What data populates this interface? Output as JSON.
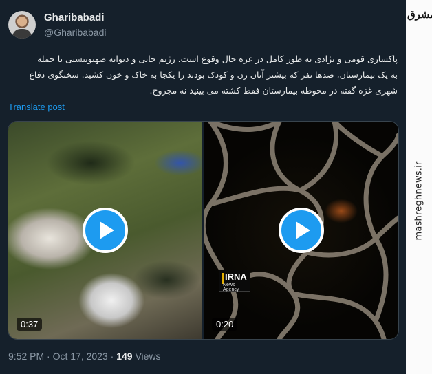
{
  "author": {
    "name": "Gharibabadi",
    "handle": "@Gharibabadi"
  },
  "tweet": {
    "lines": [
      "پاکسازی قومی و نژادی به طور کامل در غزه حال وقوع است. رژیم جانی و دیوانه صهیونیستی با حمله",
      "به یک بیمارستان، صدها نفر که بیشتر آنان زن و کودک بودند را یکجا به خاک و خون کشید. سخنگوی دفاع",
      "شهری غزه گفته در محوطه بیمارستان فقط کشته می بینید نه مجروح."
    ],
    "translate_label": "Translate post"
  },
  "videos": [
    {
      "duration": "0:37"
    },
    {
      "duration": "0:20",
      "watermark": {
        "brand": "IRNA",
        "subtitle": "News Agency"
      }
    }
  ],
  "meta": {
    "time": "9:52 PM",
    "date": "Oct 17, 2023",
    "views_count": "149",
    "views_label": "Views",
    "separator": "·"
  },
  "side_brand": {
    "logo_text": "مشرق",
    "url": "mashreghnews.ir"
  },
  "colors": {
    "background": "#15202b",
    "accent": "#1d9bf0",
    "muted": "#8b98a5",
    "text": "#e7e9ea"
  }
}
